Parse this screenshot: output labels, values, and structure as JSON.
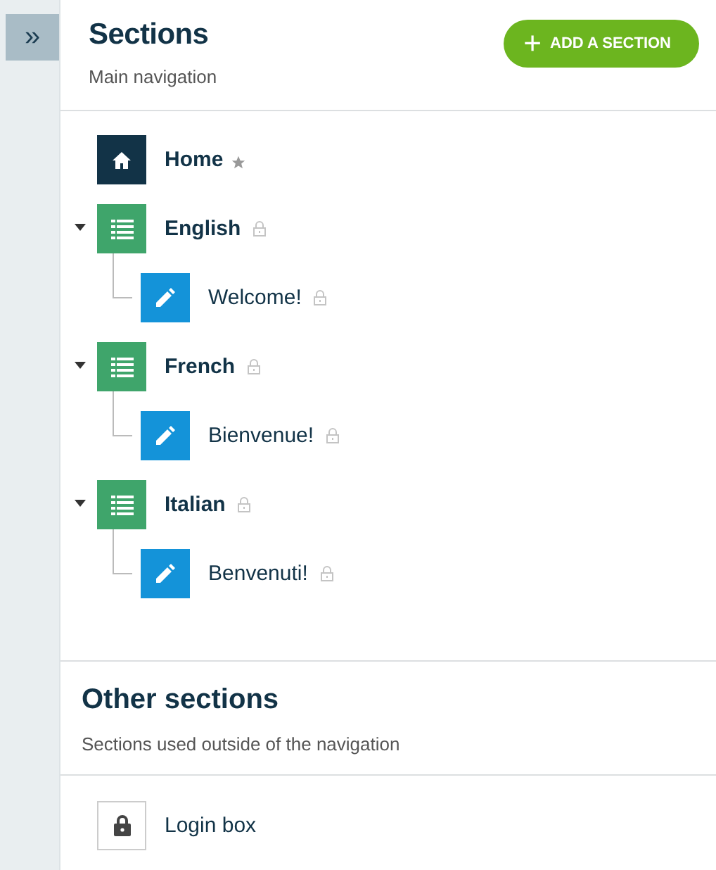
{
  "sidebar": {
    "toggle": "»"
  },
  "header": {
    "title": "Sections",
    "subtitle": "Main navigation",
    "add_button": {
      "icon": "+",
      "label": "ADD A SECTION"
    }
  },
  "tree": [
    {
      "kind": "home",
      "label": "Home",
      "starred": true,
      "locked": false
    },
    {
      "kind": "folder",
      "label": "English",
      "starred": false,
      "locked": true,
      "expanded": true,
      "children": [
        {
          "kind": "page",
          "label": "Welcome!",
          "starred": false,
          "locked": true
        }
      ]
    },
    {
      "kind": "folder",
      "label": "French",
      "starred": false,
      "locked": true,
      "expanded": true,
      "children": [
        {
          "kind": "page",
          "label": "Bienvenue!",
          "starred": false,
          "locked": true
        }
      ]
    },
    {
      "kind": "folder",
      "label": "Italian",
      "starred": false,
      "locked": true,
      "expanded": true,
      "children": [
        {
          "kind": "page",
          "label": "Benvenuti!",
          "starred": false,
          "locked": true
        }
      ]
    }
  ],
  "other": {
    "title": "Other sections",
    "subtitle": "Sections used outside of the navigation",
    "items": [
      {
        "kind": "locked",
        "label": "Login box"
      }
    ]
  }
}
